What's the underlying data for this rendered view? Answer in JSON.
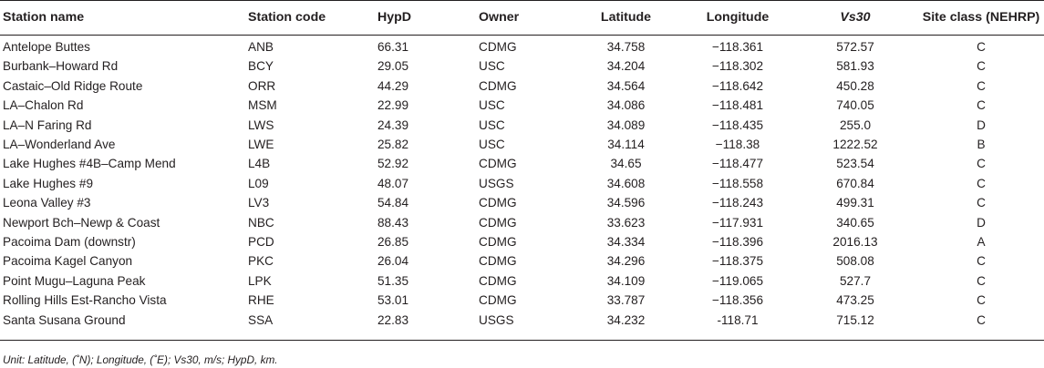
{
  "table": {
    "headers": [
      "Station name",
      "Station code",
      "HypD",
      "Owner",
      "Latitude",
      "Longitude",
      "Vs30",
      "Site class (NEHRP)"
    ],
    "rows": [
      [
        "Antelope Buttes",
        "ANB",
        "66.31",
        "CDMG",
        "34.758",
        "−118.361",
        "572.57",
        "C"
      ],
      [
        "Burbank–Howard Rd",
        "BCY",
        "29.05",
        "USC",
        "34.204",
        "−118.302",
        "581.93",
        "C"
      ],
      [
        "Castaic–Old Ridge Route",
        "ORR",
        "44.29",
        "CDMG",
        "34.564",
        "−118.642",
        "450.28",
        "C"
      ],
      [
        "LA–Chalon Rd",
        "MSM",
        "22.99",
        "USC",
        "34.086",
        "−118.481",
        "740.05",
        "C"
      ],
      [
        "LA–N Faring Rd",
        "LWS",
        "24.39",
        "USC",
        "34.089",
        "−118.435",
        "255.0",
        "D"
      ],
      [
        "LA–Wonderland Ave",
        "LWE",
        "25.82",
        "USC",
        "34.114",
        "−118.38",
        "1222.52",
        "B"
      ],
      [
        "Lake Hughes #4B–Camp Mend",
        "L4B",
        "52.92",
        "CDMG",
        "34.65",
        "−118.477",
        "523.54",
        "C"
      ],
      [
        "Lake Hughes #9",
        "L09",
        "48.07",
        "USGS",
        "34.608",
        "−118.558",
        "670.84",
        "C"
      ],
      [
        "Leona Valley #3",
        "LV3",
        "54.84",
        "CDMG",
        "34.596",
        "−118.243",
        "499.31",
        "C"
      ],
      [
        "Newport Bch–Newp & Coast",
        "NBC",
        "88.43",
        "CDMG",
        "33.623",
        "−117.931",
        "340.65",
        "D"
      ],
      [
        "Pacoima Dam (downstr)",
        "PCD",
        "26.85",
        "CDMG",
        "34.334",
        "−118.396",
        "2016.13",
        "A"
      ],
      [
        "Pacoima Kagel Canyon",
        "PKC",
        "26.04",
        "CDMG",
        "34.296",
        "−118.375",
        "508.08",
        "C"
      ],
      [
        "Point Mugu–Laguna Peak",
        "LPK",
        "51.35",
        "CDMG",
        "34.109",
        "−119.065",
        "527.7",
        "C"
      ],
      [
        "Rolling Hills Est-Rancho Vista",
        "RHE",
        "53.01",
        "CDMG",
        "33.787",
        "−118.356",
        "473.25",
        "C"
      ],
      [
        "Santa Susana Ground",
        "SSA",
        "22.83",
        "USGS",
        "34.232",
        "-118.71",
        "715.12",
        "C"
      ]
    ]
  },
  "footnote": "Unit: Latitude, (˚N); Longitude, (˚E); Vs30, m/s; HypD, km."
}
